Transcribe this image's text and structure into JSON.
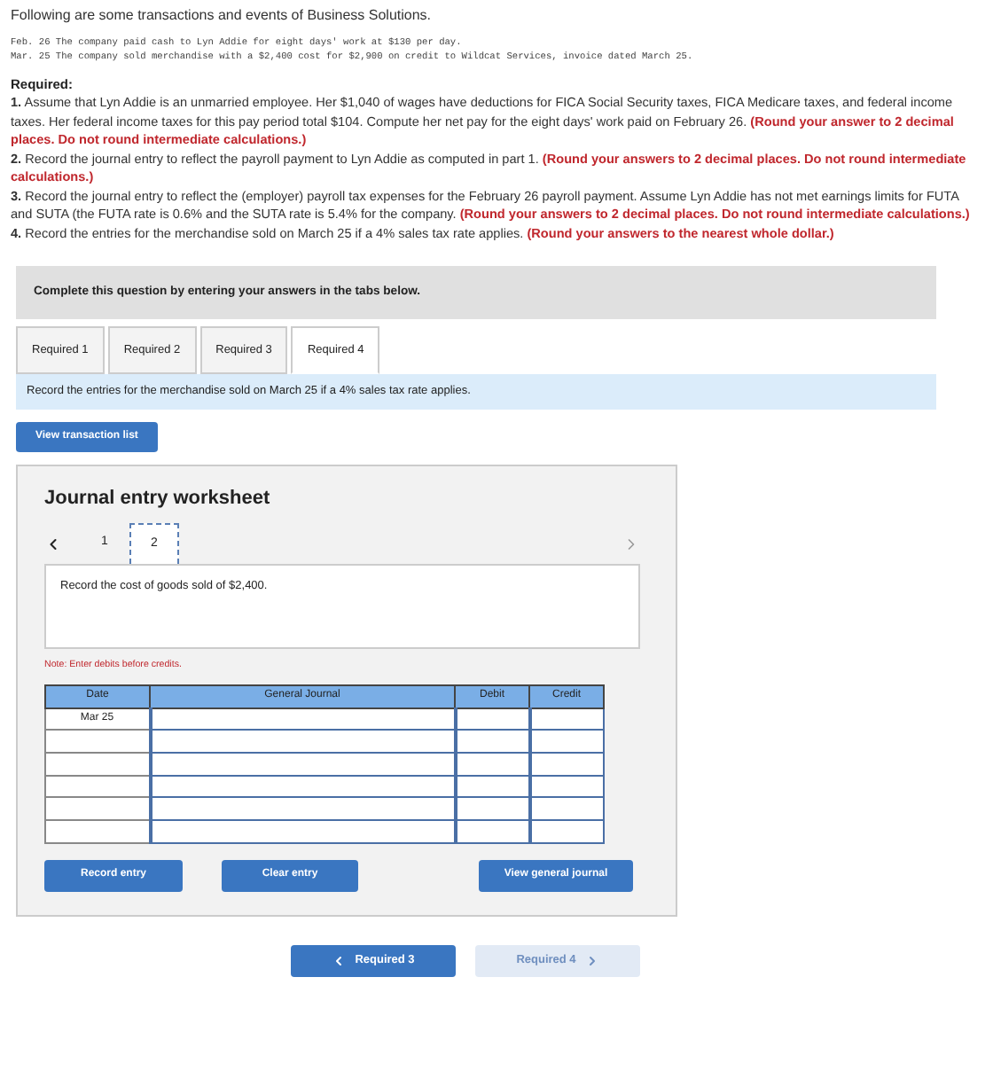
{
  "intro": "Following are some transactions and events of Business Solutions.",
  "transactions": [
    "Feb. 26 The company paid cash to Lyn Addie for eight days' work at $130 per day.",
    "Mar. 25 The company sold merchandise with a $2,400 cost for $2,900 on credit to Wildcat Services, invoice dated March 25."
  ],
  "required": {
    "heading": "Required:",
    "items": [
      {
        "number": "1.",
        "text": "Assume that Lyn Addie is an unmarried employee. Her $1,040 of wages have deductions for FICA Social Security taxes, FICA Medicare taxes, and federal income taxes. Her federal income taxes for this pay period total $104. Compute her net pay for the eight days' work paid on February 26.",
        "note": "(Round your answer to 2 decimal places. Do not round intermediate calculations.)"
      },
      {
        "number": "2.",
        "text": "Record the journal entry to reflect the payroll payment to Lyn Addie as computed in part 1.",
        "note": "(Round your answers to 2 decimal places. Do not round intermediate calculations.)"
      },
      {
        "number": "3.",
        "text": "Record the journal entry to reflect the (employer) payroll tax expenses for the February 26 payroll payment. Assume Lyn Addie has not met earnings limits for FUTA and SUTA (the FUTA rate is 0.6% and the SUTA rate is 5.4% for the company.",
        "note": "(Round your answers to 2 decimal places. Do not round intermediate calculations.)"
      },
      {
        "number": "4.",
        "text": "Record the entries for the merchandise sold on March 25 if a 4% sales tax rate applies.",
        "note": "(Round your answers to the nearest whole dollar.)"
      }
    ]
  },
  "banner": "Complete this question by entering your answers in the tabs below.",
  "tabs": [
    {
      "label": "Required 1",
      "selected": false
    },
    {
      "label": "Required 2",
      "selected": false
    },
    {
      "label": "Required 3",
      "selected": false
    },
    {
      "label": "Required 4",
      "selected": true
    }
  ],
  "instruction": "Record the entries for the merchandise sold on March 25 if a 4% sales tax rate applies.",
  "view_transactions_button": "View transaction list",
  "worksheet": {
    "title": "Journal entry worksheet",
    "pages": [
      {
        "label": "1",
        "selected": false
      },
      {
        "label": "2",
        "selected": true
      }
    ],
    "prompt": "Record the cost of goods sold of $2,400.",
    "note": "Note: Enter debits before credits.",
    "table": {
      "columns": [
        "Date",
        "General Journal",
        "Debit",
        "Credit"
      ],
      "rows": [
        {
          "date": "Mar 25"
        },
        {},
        {},
        {},
        {},
        {}
      ]
    },
    "buttons": {
      "record": "Record entry",
      "clear": "Clear entry",
      "view_journal": "View general journal"
    }
  },
  "nav": {
    "prev": {
      "label": "Required 3",
      "disabled": false
    },
    "next": {
      "label": "Required 4",
      "disabled": true
    }
  }
}
